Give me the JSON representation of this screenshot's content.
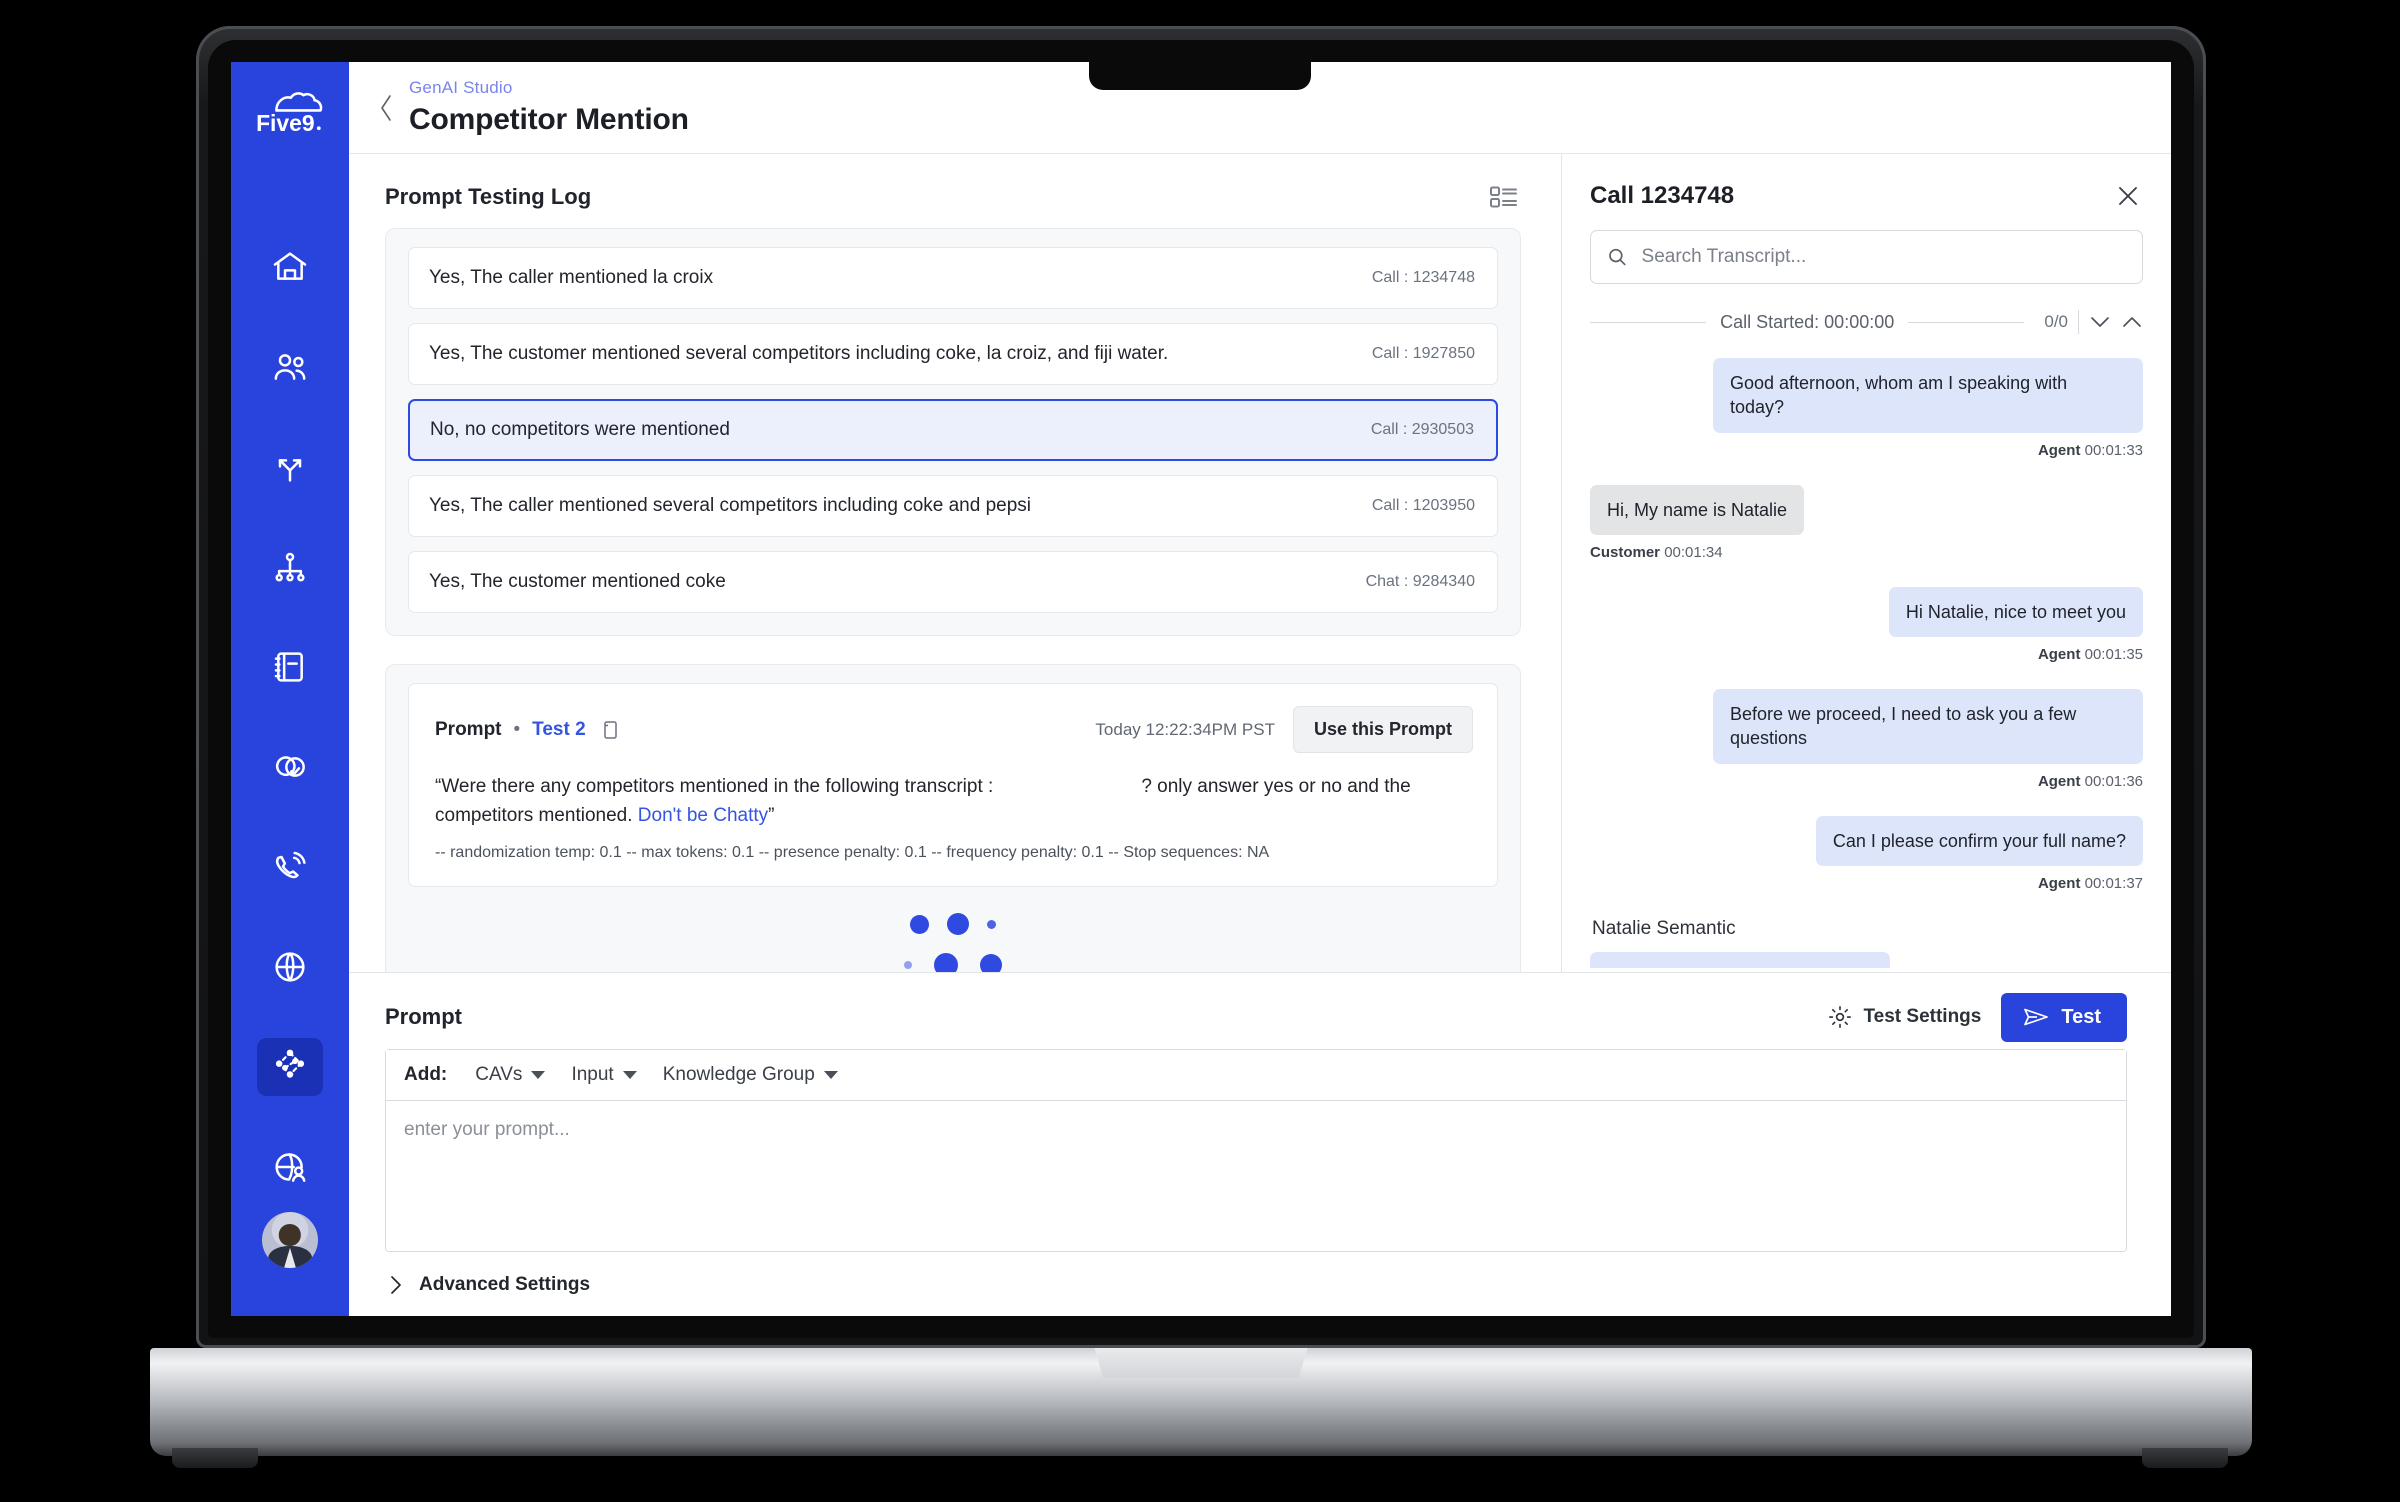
{
  "brand": {
    "logo_text": "Five9"
  },
  "sidebar": {
    "items": [
      {
        "name": "home",
        "label": "Home"
      },
      {
        "name": "users",
        "label": "Users"
      },
      {
        "name": "routing",
        "label": "Routing"
      },
      {
        "name": "hierarchy",
        "label": "Campaigns"
      },
      {
        "name": "notebook",
        "label": "Scripts"
      },
      {
        "name": "ai-brain",
        "label": "AI Insights"
      },
      {
        "name": "phone-ring",
        "label": "Voice"
      },
      {
        "name": "globe",
        "label": "Domains"
      },
      {
        "name": "genai-studio",
        "label": "GenAI Studio",
        "active": true
      },
      {
        "name": "globe-user",
        "label": "Workforce"
      }
    ]
  },
  "header": {
    "breadcrumb": "GenAI Studio",
    "title": "Competitor Mention"
  },
  "testing_log": {
    "title": "Prompt Testing Log",
    "rows": [
      {
        "text": "Yes, The caller mentioned la croix",
        "meta": "Call : 1234748",
        "selected": false
      },
      {
        "text": "Yes, The customer mentioned several competitors including coke, la croiz, and fiji water.",
        "meta": "Call  : 1927850",
        "selected": false
      },
      {
        "text": "No, no competitors were mentioned",
        "meta": "Call : 2930503",
        "selected": true
      },
      {
        "text": "Yes, The caller mentioned several competitors including coke and pepsi",
        "meta": "Call : 1203950",
        "selected": false
      },
      {
        "text": "Yes, The customer mentioned coke",
        "meta": "Chat : 9284340",
        "selected": false
      }
    ]
  },
  "prompt_card": {
    "label": "Prompt",
    "separator": "•",
    "test_name": "Test 2",
    "timestamp": "Today 12:22:34PM PST",
    "use_prompt_label": "Use this Prompt",
    "text_part1": "“Were there any competitors mentioned in the following transcript :",
    "text_part2": "? only answer yes or no and the competitors mentioned.",
    "link_text": "Don't be Chatty",
    "text_part3": "”",
    "params": "-- randomization temp: 0.1 -- max tokens: 0.1 -- presence penalty: 0.1  -- frequency penalty: 0.1 -- Stop sequences: NA"
  },
  "composer": {
    "title": "Prompt",
    "test_settings_label": "Test Settings",
    "test_button_label": "Test",
    "add_label": "Add:",
    "dropdowns": [
      {
        "label": "CAVs"
      },
      {
        "label": "Input"
      },
      {
        "label": "Knowledge Group"
      }
    ],
    "textarea_placeholder": "enter your prompt...",
    "advanced_settings_label": "Advanced Settings"
  },
  "transcript_panel": {
    "title": "Call 1234748",
    "search_placeholder": "Search Transcript...",
    "call_started_label": "Call Started: 00:00:00",
    "match_count": "0/0",
    "messages": [
      {
        "speaker": "Agent",
        "side": "agent",
        "text": "Good afternoon, whom am I speaking with today?",
        "time": "00:01:33"
      },
      {
        "speaker": "Customer",
        "side": "customer",
        "text": "Hi, My name is Natalie",
        "time": "00:01:34"
      },
      {
        "speaker": "Agent",
        "side": "agent",
        "text": "Hi Natalie, nice to meet you",
        "time": "00:01:35"
      },
      {
        "speaker": "Agent",
        "side": "agent",
        "text": "Before we proceed, I need to ask you a few questions",
        "time": "00:01:36"
      },
      {
        "speaker": "Agent",
        "side": "agent",
        "text": "Can I please confirm your full name?",
        "time": "00:01:37"
      }
    ],
    "next_speaker": "Natalie Semantic"
  },
  "colors": {
    "brand_blue": "#2943dd",
    "accent_link": "#3355e0",
    "selected_row_bg": "#eceffc",
    "agent_bubble": "#dde5fa",
    "customer_bubble": "#e3e4e6"
  }
}
